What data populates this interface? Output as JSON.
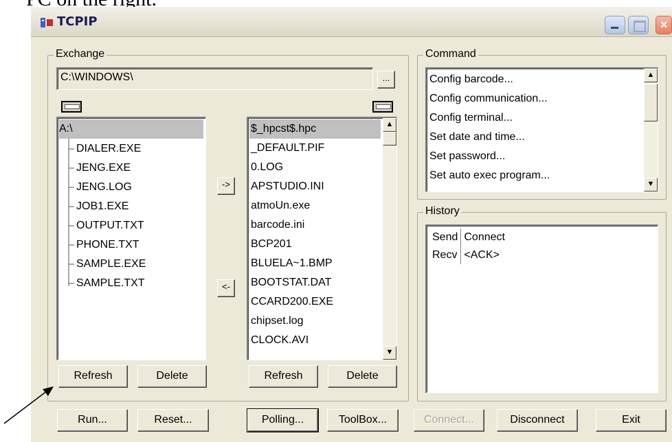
{
  "caption": "PC on the right.",
  "window": {
    "title": "TCPIP"
  },
  "exchange": {
    "label": "Exchange",
    "path": "C:\\WINDOWS\\",
    "browse_label": "...",
    "tree": {
      "root": "A:\\",
      "items": [
        "DIALER.EXE",
        "JENG.EXE",
        "JENG.LOG",
        "JOB1.EXE",
        "OUTPUT.TXT",
        "PHONE.TXT",
        "SAMPLE.EXE",
        "SAMPLE.TXT"
      ]
    },
    "to_right_label": "->",
    "to_left_label": "<-",
    "files": [
      "$_hpcst$.hpc",
      "_DEFAULT.PIF",
      "0.LOG",
      "APSTUDIO.INI",
      "atmoUn.exe",
      "barcode.ini",
      "BCP201",
      "BLUELA~1.BMP",
      "BOOTSTAT.DAT",
      "CCARD200.EXE",
      "chipset.log",
      "CLOCK.AVI"
    ],
    "left_refresh": "Refresh",
    "left_delete": "Delete",
    "right_refresh": "Refresh",
    "right_delete": "Delete"
  },
  "command": {
    "label": "Command",
    "items": [
      "Config barcode...",
      "Config communication...",
      "Config terminal...",
      "Set date and time...",
      "Set password...",
      "Set auto exec program..."
    ]
  },
  "history": {
    "label": "History",
    "rows": [
      {
        "dir": "Send",
        "msg": "Connect"
      },
      {
        "dir": "Recv",
        "msg": "<ACK>"
      }
    ]
  },
  "bottom": {
    "run": "Run...",
    "reset": "Reset...",
    "polling": "Polling...",
    "toolbox": "ToolBox...",
    "connect": "Connect...",
    "disconnect": "Disconnect",
    "exit": "Exit"
  },
  "icons": {
    "scroll_up": "up-arrow",
    "scroll_down": "down-arrow",
    "dropdown": "chevron-down"
  }
}
